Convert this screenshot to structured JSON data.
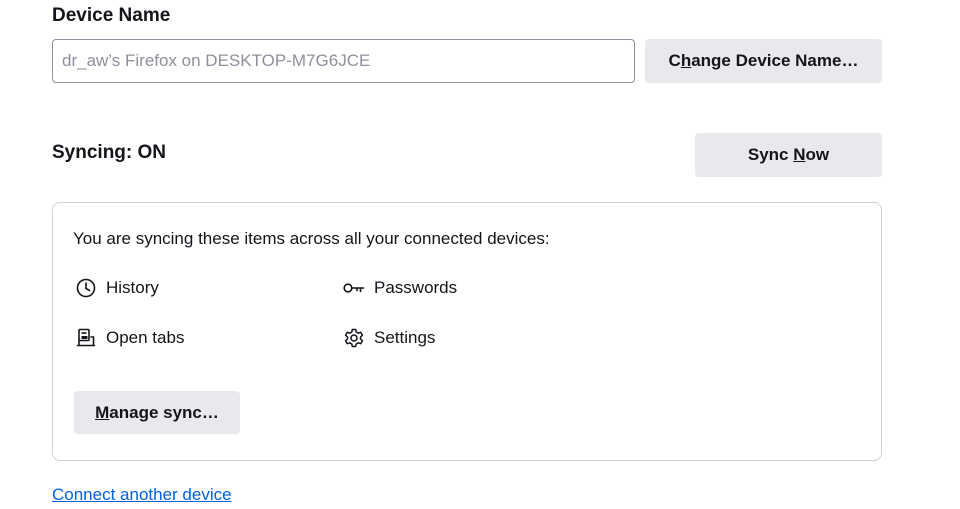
{
  "device": {
    "title": "Device Name",
    "input_placeholder": "dr_aw’s Firefox on DESKTOP-M7G6JCE",
    "change_button_pre": "C",
    "change_button_u": "h",
    "change_button_post": "ange Device Name…"
  },
  "sync": {
    "status": "Syncing: ON",
    "now_button_pre": "Sync ",
    "now_button_u": "N",
    "now_button_post": "ow",
    "description": "You are syncing these items across all your connected devices:",
    "items": [
      {
        "label": "History",
        "icon": "clock-icon"
      },
      {
        "label": "Passwords",
        "icon": "key-icon"
      },
      {
        "label": "Open tabs",
        "icon": "tabs-device-icon"
      },
      {
        "label": "Settings",
        "icon": "gear-icon"
      }
    ],
    "manage_pre": "",
    "manage_u": "M",
    "manage_post": "anage sync…"
  },
  "connect_link": "Connect another device",
  "colors": {
    "button_bg": "#e9e9ed",
    "link": "#0061e0",
    "border": "#cfcfd8",
    "text": "#15141a"
  }
}
